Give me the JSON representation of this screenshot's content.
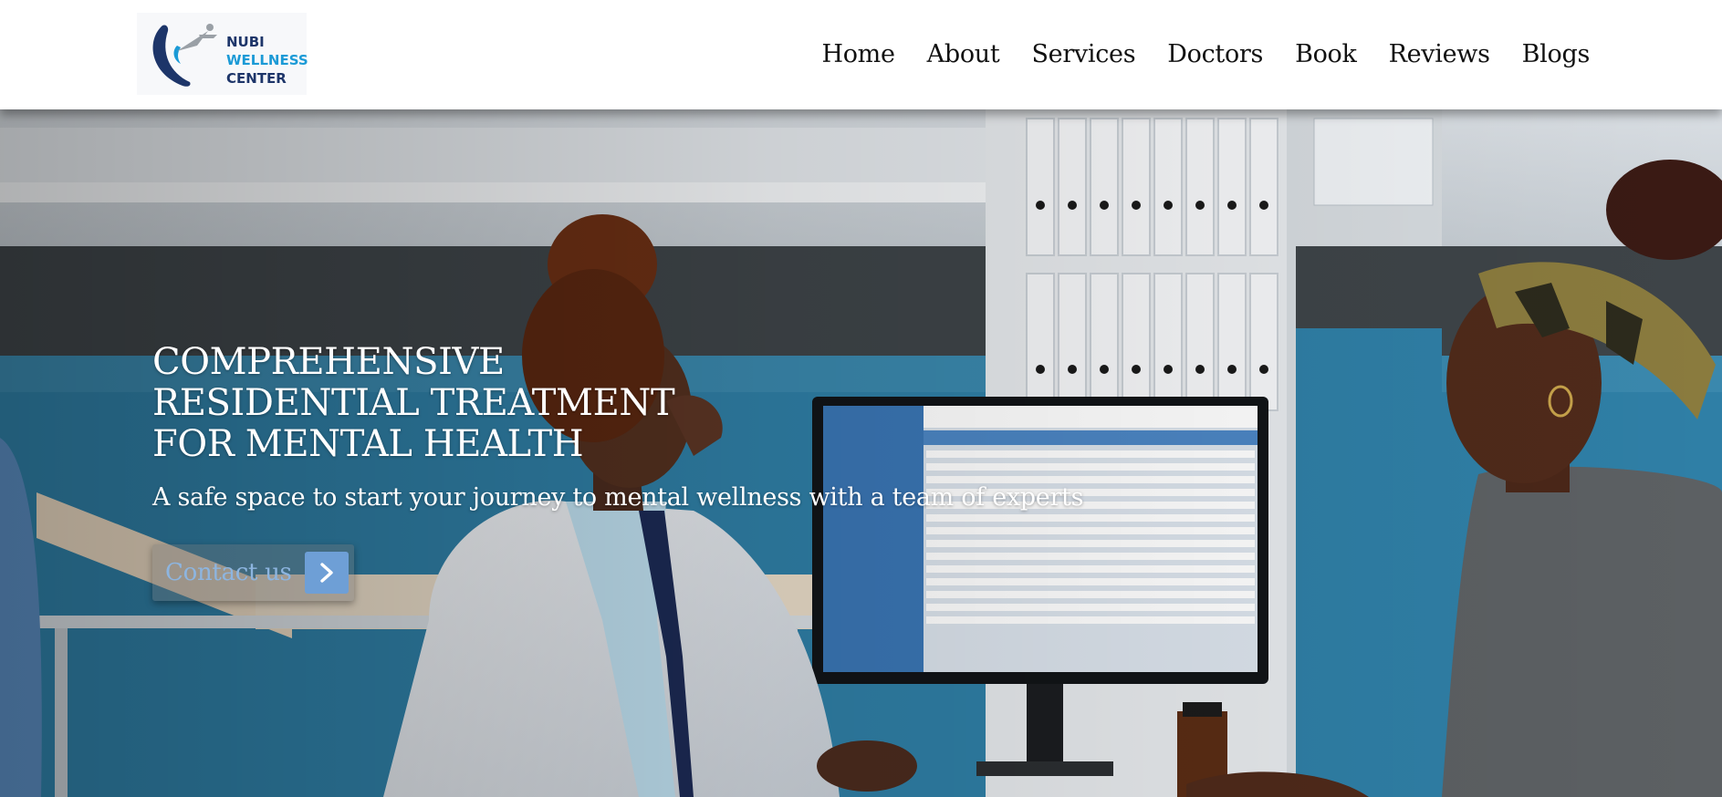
{
  "brand": {
    "line1": "NUBI",
    "line2": "WELLNESS",
    "line3": "CENTER",
    "logo_icon": "wellness-swirl-logo",
    "colors": {
      "navy": "#1d3569",
      "blue": "#1b9ad6",
      "grey": "#9aa0a6"
    }
  },
  "nav": {
    "items": [
      {
        "label": "Home"
      },
      {
        "label": "About"
      },
      {
        "label": "Services"
      },
      {
        "label": "Doctors"
      },
      {
        "label": "Book"
      },
      {
        "label": "Reviews"
      },
      {
        "label": "Blogs"
      }
    ]
  },
  "hero": {
    "title": "COMPREHENSIVE\nRESIDENTIAL TREATMENT\nFOR MENTAL HEALTH",
    "subtitle": "A safe space to start your journey to mental wellness with a team of experts",
    "cta_label": "Contact us",
    "cta_icon": "chevron-right-icon",
    "cta_color": "#6e9fd6",
    "background": "photo-doctor-consulting-patient"
  }
}
